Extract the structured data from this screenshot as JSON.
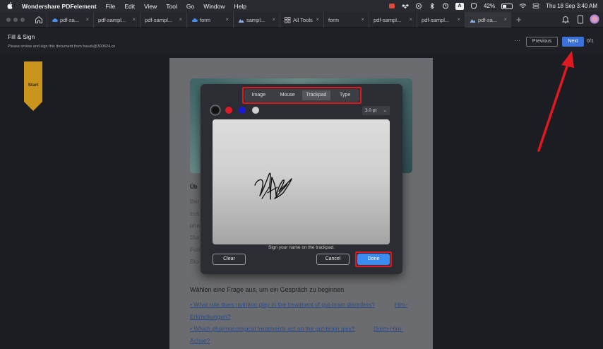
{
  "menubar": {
    "app_name": "Wondershare PDFelement",
    "menus": [
      "File",
      "Edit",
      "View",
      "Tool",
      "Go",
      "Window",
      "Help"
    ],
    "battery_percent": "42%",
    "battery_level": 0.42,
    "a_badge": "A",
    "clock": "Thu 18 Sep  3:40 AM"
  },
  "tabs": [
    {
      "label": "pdf-sa...",
      "icon": "cloud-icon"
    },
    {
      "label": "pdf-sampl...",
      "icon": "none"
    },
    {
      "label": "pdf-sampl...",
      "icon": "none"
    },
    {
      "label": "form",
      "icon": "cloud-icon"
    },
    {
      "label": "sampl...",
      "icon": "image-icon"
    },
    {
      "label": "All Tools",
      "icon": "grid-icon"
    },
    {
      "label": "form",
      "icon": "none"
    },
    {
      "label": "pdf-sampl...",
      "icon": "none"
    },
    {
      "label": "pdf-sampl...",
      "icon": "none"
    },
    {
      "label": "pdf-sa...",
      "icon": "image-icon"
    }
  ],
  "header": {
    "title": "Fill & Sign",
    "subtitle": "Please review and sign this document from hauzk@300624.cn",
    "more": "···",
    "previous": "Previous",
    "next": "Next",
    "page_count": "0/1"
  },
  "start_label": "Start",
  "document": {
    "heading": "Üb",
    "body_fragments": [
      "Bel",
      "zus",
      "pha",
      "Dia",
      "Fun",
      "Bio"
    ],
    "question_line": "Wählen eine Frage aus, um ein Gespräch zu beginnen",
    "answers": [
      "• What role does nutrition play in the treatment of gut-brain disorders?",
      "Erkrankungen?",
      "• Which pharmacological treatments act on the gut-brain axis?",
      "Achse?"
    ],
    "link_suffix_1": "Hirn-",
    "link_suffix_2": "Darm-Hirn-"
  },
  "signature_dialog": {
    "modes": [
      "Image",
      "Mouse",
      "Trackpad",
      "Type"
    ],
    "selected_mode": "Trackpad",
    "colors": [
      "#111111",
      "#e01b24",
      "#1a1ad6",
      "#cfcfcf"
    ],
    "stroke_width": "3.0 pt",
    "hint": "Sign your name on the trackpad.",
    "clear": "Clear",
    "cancel": "Cancel",
    "done": "Done"
  },
  "annotation_color": "#e0181f",
  "accent_color": "#3a72d8"
}
